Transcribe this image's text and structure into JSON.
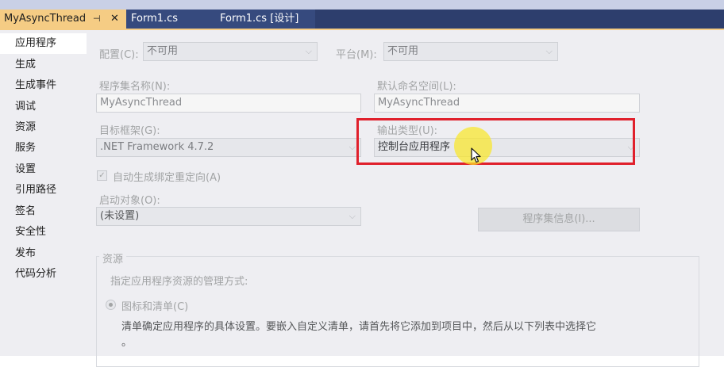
{
  "tabs": [
    {
      "label": "MyAsyncThread"
    },
    {
      "label": "Form1.cs"
    },
    {
      "label": "Form1.cs [设计]"
    }
  ],
  "tab_pin_glyph": "⊣",
  "tab_close_glyph": "✕",
  "sidebar": {
    "items": [
      {
        "label": "应用程序"
      },
      {
        "label": "生成"
      },
      {
        "label": "生成事件"
      },
      {
        "label": "调试"
      },
      {
        "label": "资源"
      },
      {
        "label": "服务"
      },
      {
        "label": "设置"
      },
      {
        "label": "引用路径"
      },
      {
        "label": "签名"
      },
      {
        "label": "安全性"
      },
      {
        "label": "发布"
      },
      {
        "label": "代码分析"
      }
    ],
    "selected": "应用程序"
  },
  "config": {
    "label": "配置(C):",
    "value": "不可用"
  },
  "platform": {
    "label": "平台(M):",
    "value": "不可用"
  },
  "assembly_name": {
    "label": "程序集名称(N):",
    "value": "MyAsyncThread"
  },
  "default_namespace": {
    "label": "默认命名空间(L):",
    "value": "MyAsyncThread"
  },
  "target_framework": {
    "label": "目标框架(G):",
    "value": ".NET Framework 4.7.2"
  },
  "output_type": {
    "label": "输出类型(U):",
    "value": "控制台应用程序"
  },
  "auto_binding": {
    "label": "自动生成绑定重定向(A)",
    "checked": true
  },
  "startup_object": {
    "label": "启动对象(O):",
    "value": "(未设置)"
  },
  "assembly_info_button": "程序集信息(I)...",
  "resources": {
    "title": "资源",
    "description": "指定应用程序资源的管理方式:",
    "option_icon_manifest": "图标和清单(C)",
    "option_detail": "清单确定应用程序的具体设置。要嵌入自定义清单，请首先将它添加到项目中，然后从以下列表中选择它",
    "option_detail_tail": "。"
  },
  "colors": {
    "tab_bar": "#2d3e6d",
    "active_tab": "#f5cc84",
    "highlight_box": "#e0202c",
    "cursor_halo": "#fae828"
  },
  "icons": {
    "dropdown": "chevron-down-icon",
    "cursor": "mouse-pointer-icon"
  }
}
